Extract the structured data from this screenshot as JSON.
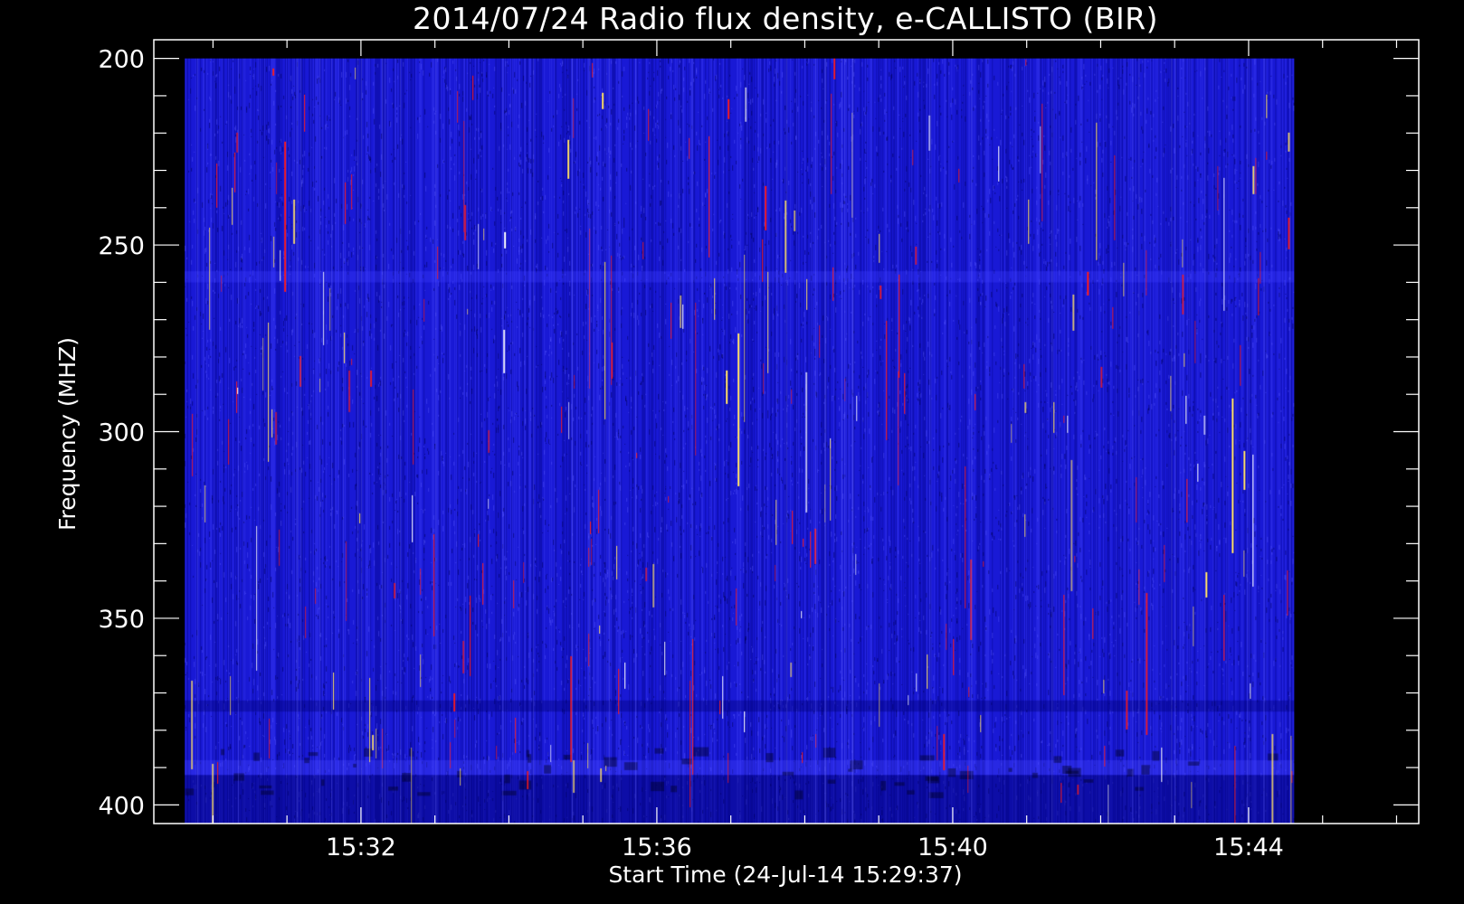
{
  "chart_data": {
    "type": "heatmap",
    "title": "2014/07/24  Radio flux density, e-CALLISTO (BIR)",
    "xlabel": "Start Time (24-Jul-14 15:29:37)",
    "ylabel": "Frequency (MHZ)",
    "x_start": "15:29:37",
    "x_end": "15:44:37",
    "xlim_minutes": [
      29.2,
      46.3
    ],
    "ylim": [
      405,
      195
    ],
    "y_inverted": true,
    "x_ticks": [
      {
        "value": 32,
        "label": "15:32"
      },
      {
        "value": 36,
        "label": "15:36"
      },
      {
        "value": 40,
        "label": "15:40"
      },
      {
        "value": 44,
        "label": "15:44"
      }
    ],
    "x_minor_step_minutes": 1,
    "y_ticks": [
      {
        "value": 200,
        "label": "200"
      },
      {
        "value": 250,
        "label": "250"
      },
      {
        "value": 300,
        "label": "300"
      },
      {
        "value": 350,
        "label": "350"
      },
      {
        "value": 400,
        "label": "400"
      }
    ],
    "y_minor_step": 10,
    "frequency_range_mhz": [
      200,
      405
    ],
    "colormap": [
      "#0000a0",
      "#1f1fe0",
      "#3a3aff",
      "#ff1a1a",
      "#ffe066",
      "#ffffff"
    ],
    "background_color": "#1a1ad8",
    "grid": false,
    "legend": "none"
  }
}
